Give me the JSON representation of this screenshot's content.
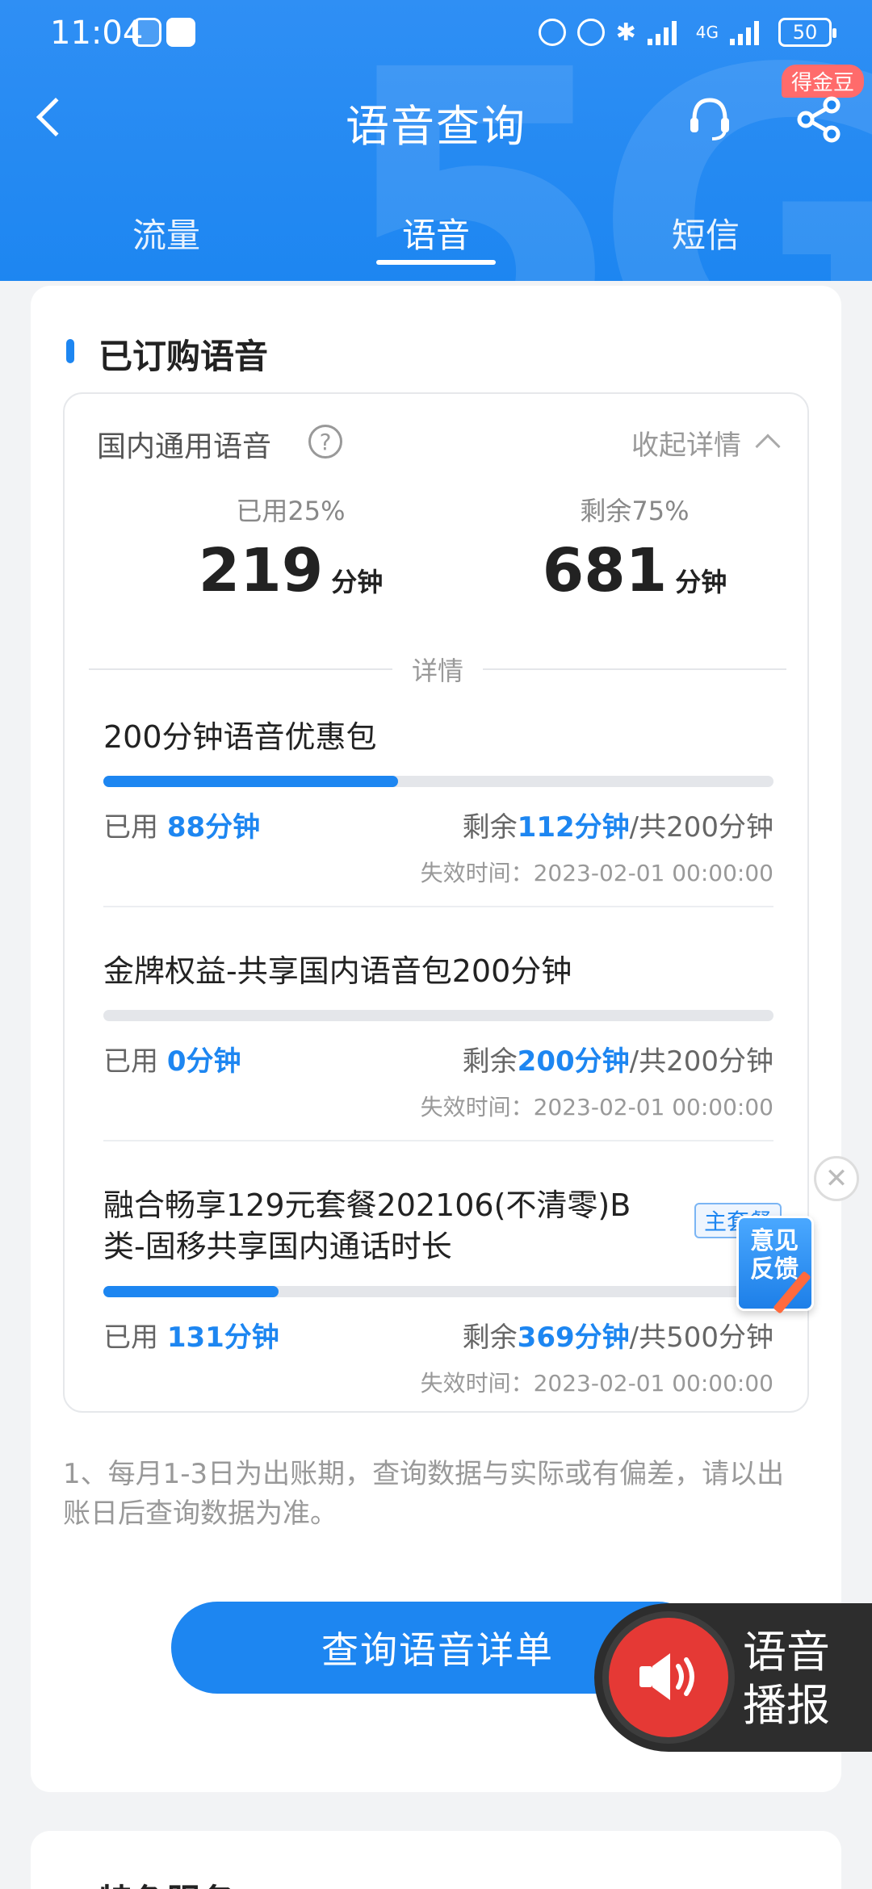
{
  "status_bar": {
    "time": "11:04",
    "battery": "50",
    "network": "4G"
  },
  "nav": {
    "title": "语音查询",
    "badge": "得金豆"
  },
  "tabs": [
    {
      "label": "流量",
      "active": false
    },
    {
      "label": "语音",
      "active": true
    },
    {
      "label": "短信",
      "active": false
    }
  ],
  "section": {
    "title": "已订购语音",
    "category": "国内通用语音",
    "help": "?",
    "collapse_label": "收起详情",
    "used_pct_label": "已用25%",
    "used_value": "219",
    "remain_pct_label": "剩余75%",
    "remain_value": "681",
    "unit": "分钟",
    "divider_label": "详情"
  },
  "packages": [
    {
      "name": "200分钟语音优惠包",
      "used_prefix": "已用 ",
      "used": "88分钟",
      "remain_prefix": "剩余",
      "remain": "112分钟",
      "total": "/共200分钟",
      "expire": "失效时间：2023-02-01 00:00:00",
      "progress": 0.44
    },
    {
      "name": "金牌权益-共享国内语音包200分钟",
      "used_prefix": "已用 ",
      "used": "0分钟",
      "remain_prefix": "剩余",
      "remain": "200分钟",
      "total": "/共200分钟",
      "expire": "失效时间：2023-02-01 00:00:00",
      "progress": 0.0
    },
    {
      "name": "融合畅享129元套餐202106(不清零)B类-固移共享国内通话时长",
      "tag": "主套餐",
      "used_prefix": "已用 ",
      "used": "131分钟",
      "remain_prefix": "剩余",
      "remain": "369分钟",
      "total": "/共500分钟",
      "expire": "失效时间：2023-02-01 00:00:00",
      "progress": 0.262
    }
  ],
  "note": "1、每月1-3日为出账期，查询数据与实际或有偏差，请以出账日后查询数据为准。",
  "query_button": "查询语音详单",
  "next_section_title": "特色服务",
  "feedback": {
    "line1": "意见",
    "line2": "反馈"
  },
  "voice_broadcast": {
    "line1": "语音",
    "line2": "播报"
  },
  "colors": {
    "primary": "#1d86f1",
    "header": "#2f8ff4",
    "badge": "#ff6b6b",
    "voice_button": "#e53935"
  }
}
